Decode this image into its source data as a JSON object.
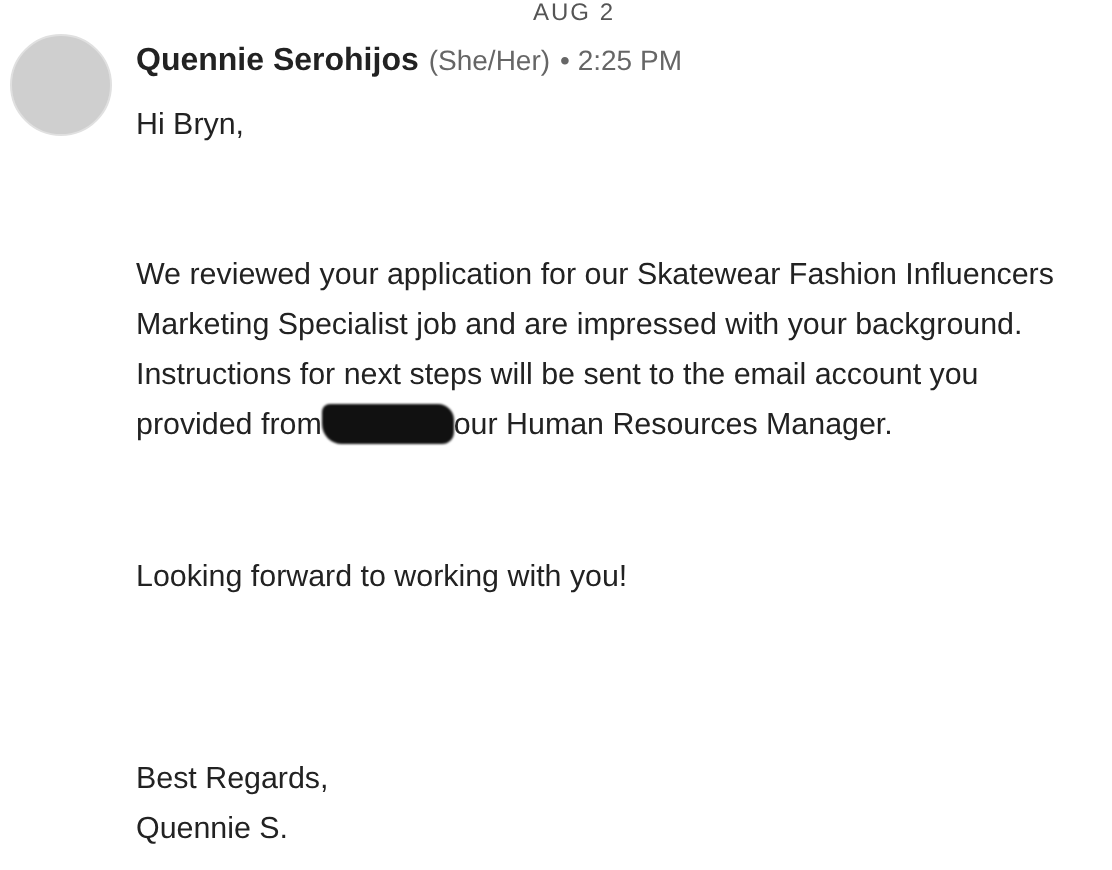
{
  "date_divider": "AUG 2",
  "message": {
    "sender": "Quennie Serohijos",
    "pronouns": "(She/Her)",
    "time": "• 2:25 PM",
    "paragraphs": [
      {
        "segments": [
          {
            "kind": "text",
            "text": "Hi Bryn,"
          }
        ]
      },
      {
        "segments": [
          {
            "kind": "text",
            "text": "We reviewed your application for our Skatewear Fashion Influencers Marketing Specialist job and are impressed with your background. Instructions for next steps will be sent to the email account you provided from"
          },
          {
            "kind": "redaction"
          },
          {
            "kind": "text",
            "text": "our Human Resources Manager."
          }
        ]
      },
      {
        "segments": [
          {
            "kind": "text",
            "text": "Looking forward to working with you!"
          }
        ]
      },
      {
        "segments": [
          {
            "kind": "text",
            "text": "Best Regards,"
          }
        ]
      },
      {
        "segments": [
          {
            "kind": "text",
            "text": "Quennie S."
          }
        ]
      }
    ]
  }
}
